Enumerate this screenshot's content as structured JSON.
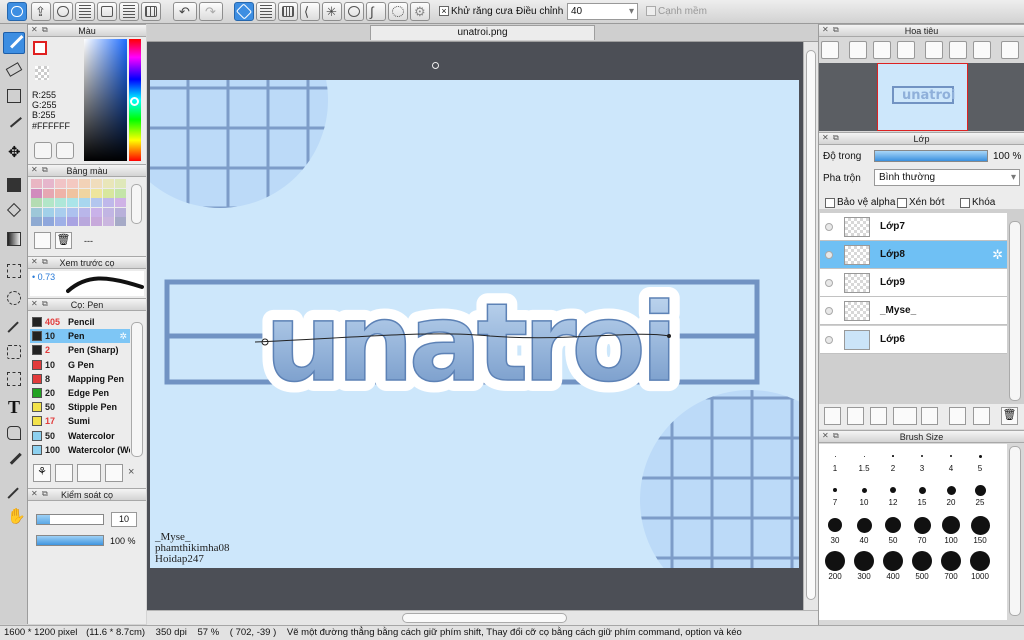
{
  "toolbar": {
    "antialias_label": "Khử răng cưa",
    "adjust_label": "Điều chỉnh",
    "adjust_value": "40",
    "soft_edge_label": "Cạnh mềm"
  },
  "document": {
    "tab_title": "unatroi.png"
  },
  "color_panel": {
    "title": "Màu",
    "r": "R:255",
    "g": "G:255",
    "b": "B:255",
    "hex": "#FFFFFF"
  },
  "palette_panel": {
    "title": "Bảng màu",
    "dash": "---",
    "colors": [
      "#e9b6c3",
      "#e6b6cc",
      "#f1c4c6",
      "#f4c9c1",
      "#f2d2b7",
      "#f0ddbc",
      "#e9e6b9",
      "#dfe8b9",
      "#d18cbd",
      "#e6a7b2",
      "#efb3a8",
      "#f0c3a0",
      "#efd5a1",
      "#eee59c",
      "#d8e79e",
      "#c4e5a8",
      "#b4dcb3",
      "#b2e6c8",
      "#aee7d9",
      "#aae4e9",
      "#a8d6ef",
      "#b3c6ee",
      "#bfb8ea",
      "#cfb2e6",
      "#9dc7d8",
      "#a1d0e9",
      "#a9cdee",
      "#adc1ef",
      "#b9b6ea",
      "#c9b2e9",
      "#c1b5e3",
      "#b8b0da",
      "#8eaad2",
      "#8fa7dc",
      "#9fb0e7",
      "#a9a3e2",
      "#b9a8dd",
      "#c7a9db",
      "#cab6df",
      "#a6aac7"
    ]
  },
  "preview_panel": {
    "title": "Xem trước cọ",
    "size": "0.73"
  },
  "brush_panel": {
    "title": "Cọ: Pen",
    "brushes": [
      {
        "size": "405",
        "name": "Pencil",
        "color": "#222222",
        "sizecolor": "#e23b3b"
      },
      {
        "size": "10",
        "name": "Pen",
        "color": "#222222",
        "sizecolor": "#222222"
      },
      {
        "size": "2",
        "name": "Pen (Sharp)",
        "color": "#222222",
        "sizecolor": "#e23b3b"
      },
      {
        "size": "10",
        "name": "G Pen",
        "color": "#e23b3b",
        "sizecolor": "#222222"
      },
      {
        "size": "8",
        "name": "Mapping Pen",
        "color": "#e23b3b",
        "sizecolor": "#222222"
      },
      {
        "size": "20",
        "name": "Edge Pen",
        "color": "#22a222",
        "sizecolor": "#222222"
      },
      {
        "size": "50",
        "name": "Stipple Pen",
        "color": "#f2e24a",
        "sizecolor": "#222222"
      },
      {
        "size": "17",
        "name": "Sumi",
        "color": "#f2e24a",
        "sizecolor": "#e23b3b"
      },
      {
        "size": "50",
        "name": "Watercolor",
        "color": "#8cd0ef",
        "sizecolor": "#222222"
      },
      {
        "size": "100",
        "name": "Watercolor (We",
        "color": "#8cd0ef",
        "sizecolor": "#222222"
      }
    ]
  },
  "control_panel": {
    "title": "Kiểm soát cọ",
    "size_value": "10",
    "opacity_value": "100 %",
    "opacity": 1.0
  },
  "navigator": {
    "title": "Hoa tiêu"
  },
  "layer_panel": {
    "title": "Lớp",
    "opacity_label": "Độ trong",
    "opacity_value": "100 %",
    "opacity": 1.0,
    "blend_label": "Pha trộn",
    "blend_value": "Bình thường",
    "protect_alpha": "Bảo vệ alpha",
    "clip": "Xén bớt",
    "lock": "Khóa",
    "layers": [
      "Lớp7",
      "Lớp8",
      "Lớp9",
      "_Myse_",
      "Lớp6"
    ]
  },
  "brush_size_panel": {
    "title": "Brush Size",
    "sizes": [
      "1",
      "1.5",
      "2",
      "3",
      "4",
      "5",
      "7",
      "10",
      "12",
      "15",
      "20",
      "25",
      "30",
      "40",
      "50",
      "70",
      "100",
      "150",
      "200",
      "300",
      "400",
      "500",
      "700",
      "1000"
    ]
  },
  "artwork": {
    "text": "unatroi",
    "credit": [
      "_Myse_",
      "phamthikimha08",
      "Hoidap247"
    ]
  },
  "status": {
    "dimensions": "1600 * 1200 pixel",
    "physical": "(11.6 * 8.7cm)",
    "dpi": "350 dpi",
    "zoom": "57 %",
    "coords": "( 702, -39 )",
    "hint": "Vẽ một đường thẳng bằng cách giữ phím shift, Thay đổi cỡ cọ bằng cách giữ phím command, option và kéo"
  }
}
